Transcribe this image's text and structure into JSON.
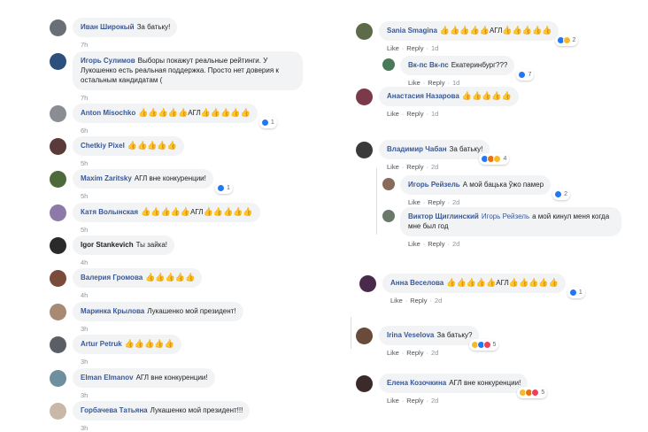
{
  "reactions_colors": {
    "like": "#2078f4",
    "laugh": "#f7b928",
    "angry": "#e9710f",
    "love": "#f33e58"
  },
  "ui": {
    "like": "Like",
    "reply": "Reply",
    "sep": "·"
  },
  "left": [
    {
      "author": "Иван Широкый",
      "text": "За батьку!",
      "time": "7h"
    },
    {
      "author": "Игорь Сулимов",
      "text": "Выборы покажут реальные рейтинги. У Лукошенко есть реальная поддержка. Просто нет доверия к остальным кандидатам (",
      "time": "7h"
    },
    {
      "author": "Anton Misochko",
      "emoji1": "👍👍👍👍👍",
      "text": "АГЛ",
      "emoji2": "👍👍👍👍👍",
      "time": "6h",
      "react": "1"
    },
    {
      "author": "Chetkiy Pixel",
      "emoji1": "👍👍👍👍👍",
      "text": "",
      "time": "5h"
    },
    {
      "author": "Maxim Zaritsky",
      "text": "АГЛ вне конкуренции!",
      "time": "5h",
      "react": "1"
    },
    {
      "author": "Катя Волынская",
      "emoji1": "👍👍👍👍👍",
      "text": "АГЛ",
      "emoji2": "👍👍👍👍👍",
      "time": "5h"
    },
    {
      "author": "Igor Stankevich",
      "text": "Ты зайка!",
      "time": "4h"
    },
    {
      "author": "Валерия Громова",
      "emoji1": "👍👍👍👍👍",
      "text": "",
      "time": "4h"
    },
    {
      "author": "Маринка Крылова",
      "text": "Лукашенко мой президент!",
      "time": "3h"
    },
    {
      "author": "Artur Petruk",
      "emoji1": "👍👍👍👍👍",
      "text": "",
      "time": "3h"
    },
    {
      "author": "Elman Elmanov",
      "text": "АГЛ вне конкуренции!",
      "time": "3h"
    },
    {
      "author": "Горбачева Татьяна",
      "text": "Лукашенко мой президент!!!",
      "time": "3h"
    }
  ],
  "right": [
    {
      "author": "Sania Smagina",
      "emoji1": "👍👍👍👍👍",
      "text": "АГЛ",
      "emoji2": "👍👍👍👍👍",
      "time": "1d",
      "react": "2"
    },
    {
      "author": "Вк-пс Вк-пс",
      "text": "Екатеринбург???",
      "time": "1d",
      "react": "7"
    },
    {
      "author": "Анастасия Назарова",
      "emoji1": "👍👍👍👍👍",
      "text": "",
      "time": "1d"
    },
    {
      "author": "Владимир Чабан",
      "text": "За батьку!",
      "time": "2d",
      "react": "4"
    },
    {
      "author": "Игорь Рейзель",
      "text": "А мой бацька ўжо памер",
      "time": "2d",
      "react": "2"
    },
    {
      "author": "Виктор Щиглинский",
      "mention": "Игорь Рейзель",
      "text": "а мой кинул меня когда мне был год",
      "time": "2d"
    },
    {
      "author": "Анна Веселова",
      "emoji1": "👍👍👍👍👍",
      "text": "АГЛ",
      "emoji2": "👍👍👍👍👍",
      "time": "2d",
      "react": "1"
    },
    {
      "author": "Irina Veselova",
      "text": "За батьку?",
      "time": "2d",
      "react": "5"
    },
    {
      "author": "Елена Козочкина",
      "text": "АГЛ вне конкуренции!",
      "time": "2d",
      "react": "5"
    }
  ]
}
